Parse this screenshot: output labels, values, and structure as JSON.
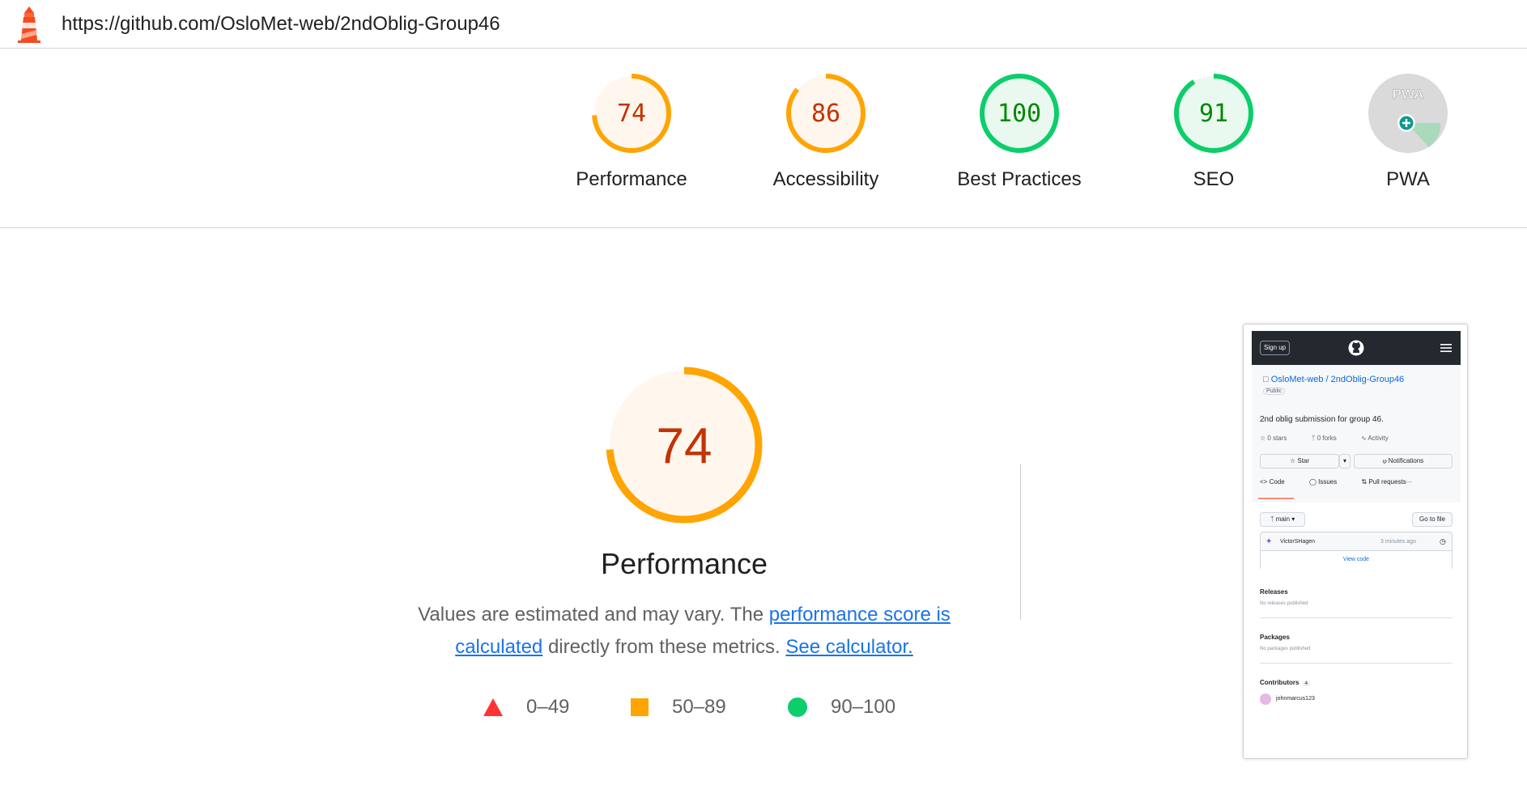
{
  "header": {
    "url": "https://github.com/OsloMet-web/2ndOblig-Group46"
  },
  "colors": {
    "fail": "#ff3333",
    "average": "#ffa400",
    "pass": "#0cce6b",
    "average_text": "#c33300",
    "pass_text": "#008800",
    "link": "#1a73e8"
  },
  "scores": [
    {
      "label": "Performance",
      "value": "74",
      "fraction": 0.74,
      "rating": "average"
    },
    {
      "label": "Accessibility",
      "value": "86",
      "fraction": 0.86,
      "rating": "average"
    },
    {
      "label": "Best Practices",
      "value": "100",
      "fraction": 1.0,
      "rating": "pass"
    },
    {
      "label": "SEO",
      "value": "91",
      "fraction": 0.91,
      "rating": "pass"
    },
    {
      "label": "PWA",
      "value": "",
      "badge_text": "PWA",
      "rating": "pwa"
    }
  ],
  "main": {
    "score": "74",
    "fraction": 0.74,
    "title": "Performance",
    "desc_prefix": "Values are estimated and may vary. The ",
    "desc_link1": "performance score is calculated",
    "desc_middle": " directly from these metrics. ",
    "desc_link2": "See calculator.",
    "legend": [
      {
        "range": "0–49",
        "shape": "triangle",
        "icon": "fail-triangle-icon"
      },
      {
        "range": "50–89",
        "shape": "square",
        "icon": "average-square-icon"
      },
      {
        "range": "90–100",
        "shape": "circle",
        "icon": "pass-circle-icon"
      }
    ]
  },
  "thumbnail": {
    "sign_up": "Sign up",
    "repo_owner": "OsloMet-web",
    "repo_sep": " / ",
    "repo_name": "2ndOblig-Group46",
    "visibility": "Public",
    "description": "2nd oblig submission for group 46.",
    "stars": "0 stars",
    "forks": "0 forks",
    "activity": "Activity",
    "star_btn": "Star",
    "notifications_btn": "Notifications",
    "tab_code": "Code",
    "tab_issues": "Issues",
    "tab_pulls": "Pull requests",
    "branch": "main",
    "go_to_file": "Go to file",
    "commit_author": "VictorSHagen",
    "commit_time": "3 minutes ago",
    "view_code": "View code",
    "releases_title": "Releases",
    "releases_text": "No releases published",
    "packages_title": "Packages",
    "packages_text": "No packages published",
    "contributors_title": "Contributors",
    "contributors_count": "4",
    "contributor_1": "johnmarcus123"
  }
}
